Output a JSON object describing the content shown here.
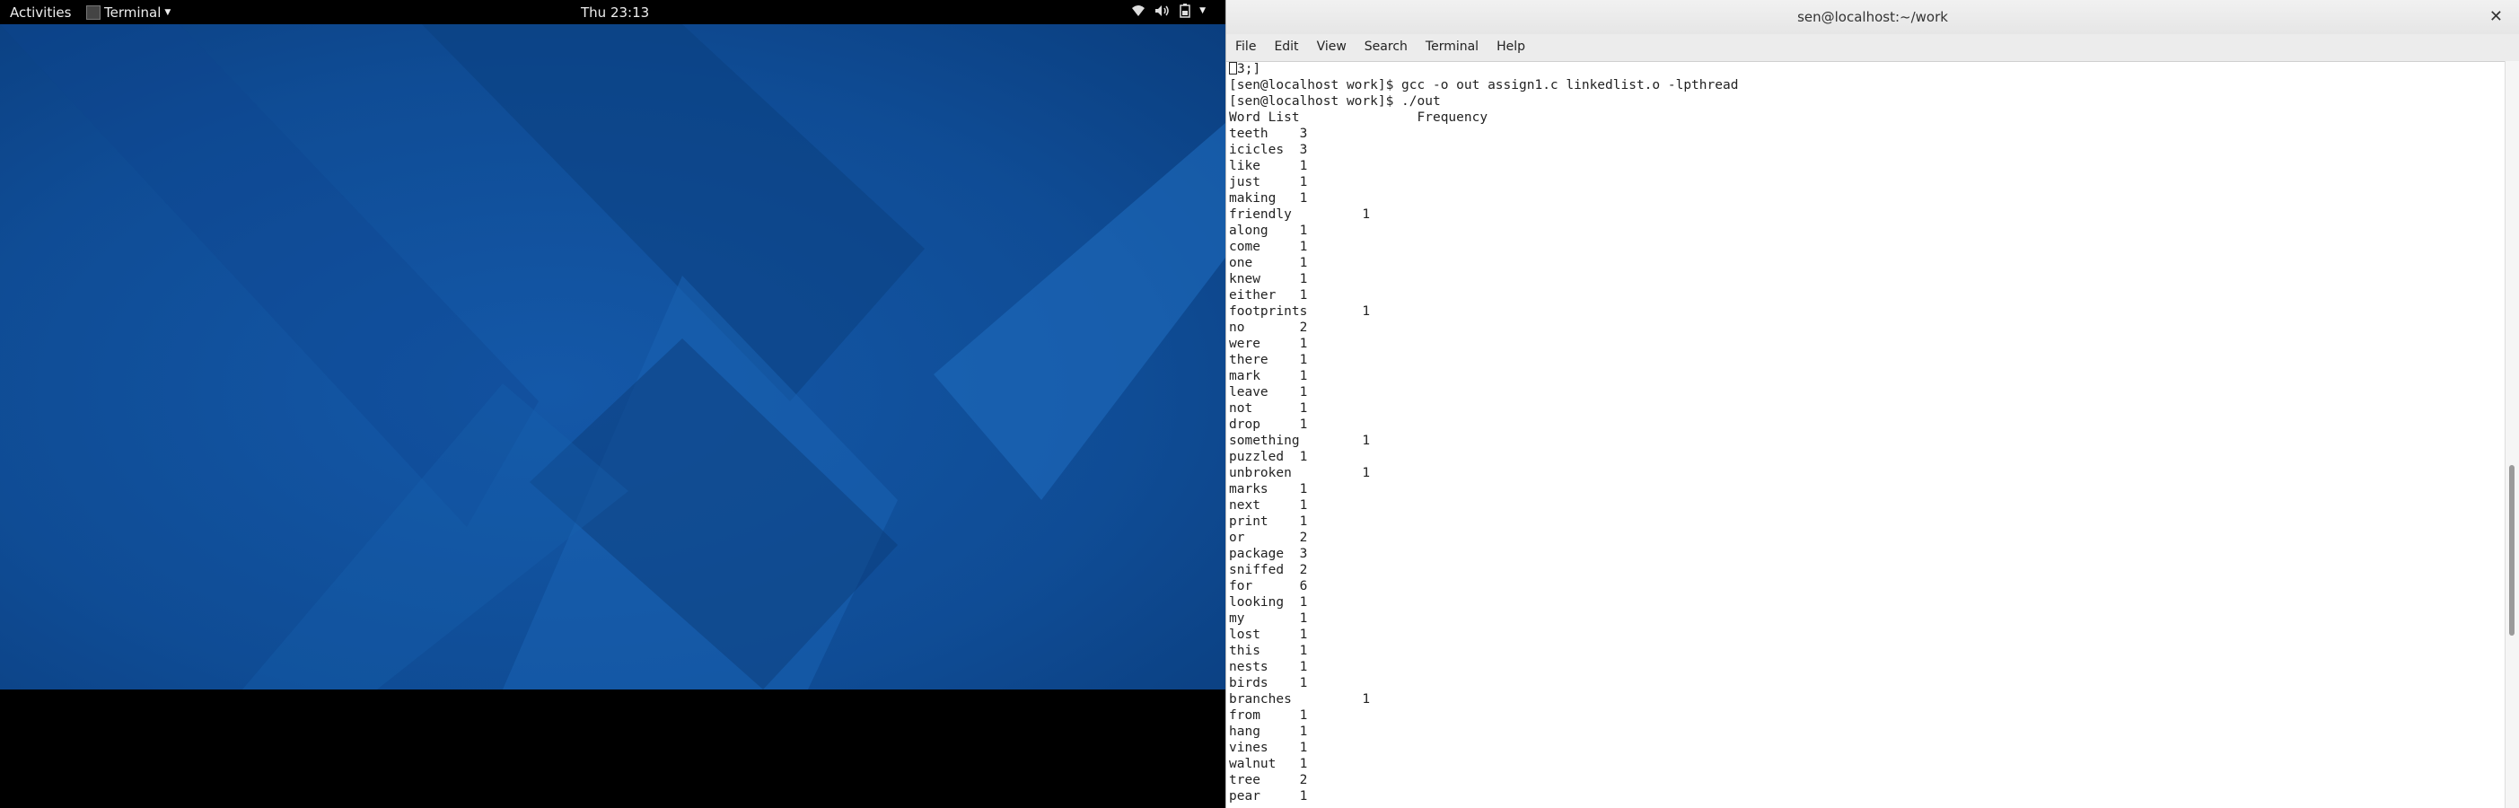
{
  "topbar": {
    "activities": "Activities",
    "app_name": "Terminal",
    "clock": "Thu 23:13",
    "icons": [
      "wifi-icon",
      "volume-icon",
      "battery-icon",
      "chevron-down-icon"
    ]
  },
  "colors": {
    "wallpaper_base": "#0f4c95",
    "wallpaper_light": "#1b66b6",
    "wallpaper_dark": "#083a78"
  },
  "terminal": {
    "title": "sen@localhost:~/work",
    "menu": [
      "File",
      "Edit",
      "View",
      "Search",
      "Terminal",
      "Help"
    ],
    "lines": [
      "3;]",
      "[sen@localhost work]$ gcc -o out assign1.c linkedlist.o -lpthread",
      "[sen@localhost work]$ ./out",
      "Word List               Frequency",
      "teeth    3",
      "icicles  3",
      "like     1",
      "just     1",
      "making   1",
      "friendly         1",
      "along    1",
      "come     1",
      "one      1",
      "knew     1",
      "either   1",
      "footprints       1",
      "no       2",
      "were     1",
      "there    1",
      "mark     1",
      "leave    1",
      "not      1",
      "drop     1",
      "something        1",
      "puzzled  1",
      "unbroken         1",
      "marks    1",
      "next     1",
      "print    1",
      "or       2",
      "package  3",
      "sniffed  2",
      "for      6",
      "looking  1",
      "my       1",
      "lost     1",
      "this     1",
      "nests    1",
      "birds    1",
      "branches         1",
      "from     1",
      "hang     1",
      "vines    1",
      "walnut   1",
      "tree     2",
      "pear     1"
    ]
  }
}
